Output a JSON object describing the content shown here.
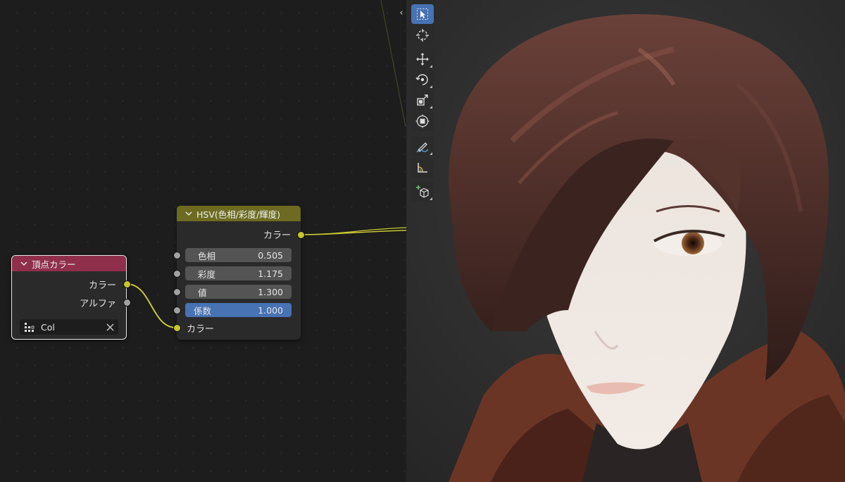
{
  "colors": {
    "accent": "#4772b3",
    "vertex_color_header": "#8f2f4c",
    "hsv_header": "#6c6b21",
    "socket_color": "#c7c729",
    "socket_grey": "#a1a1a1",
    "link_color": "#c9c933"
  },
  "vertex_color_node": {
    "title": "頂点カラー",
    "outputs": [
      "カラー",
      "アルファ"
    ],
    "attribute": {
      "value": "Col",
      "icon": "vertex-color-attribute-icon",
      "clear_icon": "close-icon"
    }
  },
  "hsv_node": {
    "title": "HSV(色相/彩度/輝度)",
    "output": "カラー",
    "fields": [
      {
        "label": "色相",
        "value": "0.505",
        "active": false
      },
      {
        "label": "彩度",
        "value": "1.175",
        "active": false
      },
      {
        "label": "値",
        "value": "1.300",
        "active": false
      },
      {
        "label": "係数",
        "value": "1.000",
        "active": true
      }
    ],
    "input": "カラー"
  },
  "toolbar": {
    "collapse_icon": "chevron-left-icon",
    "tools": [
      {
        "name": "select-box-tool",
        "icon": "cursor-arrow-icon",
        "active": true
      },
      {
        "name": "cursor-tool",
        "icon": "3d-cursor-icon",
        "active": false
      },
      {
        "name": "move-tool",
        "icon": "move-arrows-icon",
        "active": false
      },
      {
        "name": "rotate-tool",
        "icon": "rotate-icon",
        "active": false
      },
      {
        "name": "scale-tool",
        "icon": "scale-icon",
        "active": false
      },
      {
        "name": "transform-tool",
        "icon": "transform-icon",
        "active": false
      },
      {
        "name": "annotate-tool",
        "icon": "annotate-pencil-icon",
        "active": false
      },
      {
        "name": "measure-tool",
        "icon": "measure-ruler-icon",
        "active": false
      },
      {
        "name": "add-cube-tool",
        "icon": "add-cube-icon",
        "active": false
      }
    ]
  }
}
